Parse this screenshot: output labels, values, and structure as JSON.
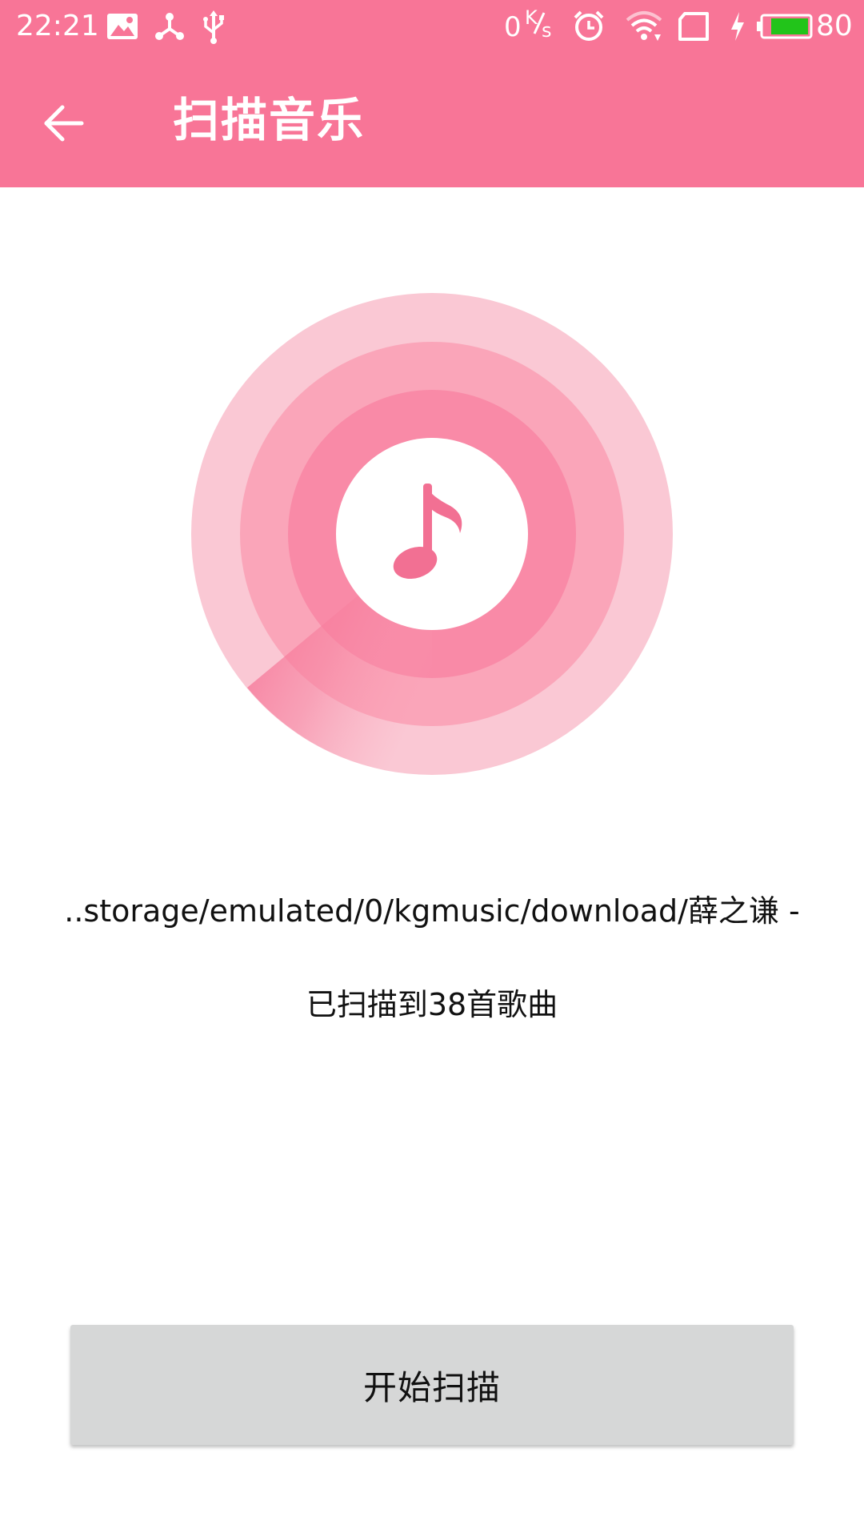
{
  "status_bar": {
    "time": "22:21",
    "network_speed_value": "0",
    "network_speed_unit_top": "K",
    "network_speed_unit_bottom": "s",
    "battery_level": "80",
    "background_color": "#f87597",
    "battery_fill_color": "#22c41a",
    "icons": [
      "image-notification-icon",
      "share-notification-icon",
      "usb-icon",
      "alarm-icon",
      "wifi-icon",
      "sim-card-icon",
      "charging-icon",
      "battery-icon"
    ]
  },
  "app_bar": {
    "title": "扫描音乐",
    "background_color": "#f87597"
  },
  "scan_graphic": {
    "ring_colors": [
      "#fac8d4",
      "#faa5b9",
      "#f98aa7"
    ],
    "note_color": "#f27093",
    "icon": "music-note-icon"
  },
  "scan": {
    "current_path": "..storage/emulated/0/kgmusic/download/薛之谦 -",
    "result_text": "已扫描到38首歌曲"
  },
  "actions": {
    "start_scan_label": "开始扫描"
  }
}
